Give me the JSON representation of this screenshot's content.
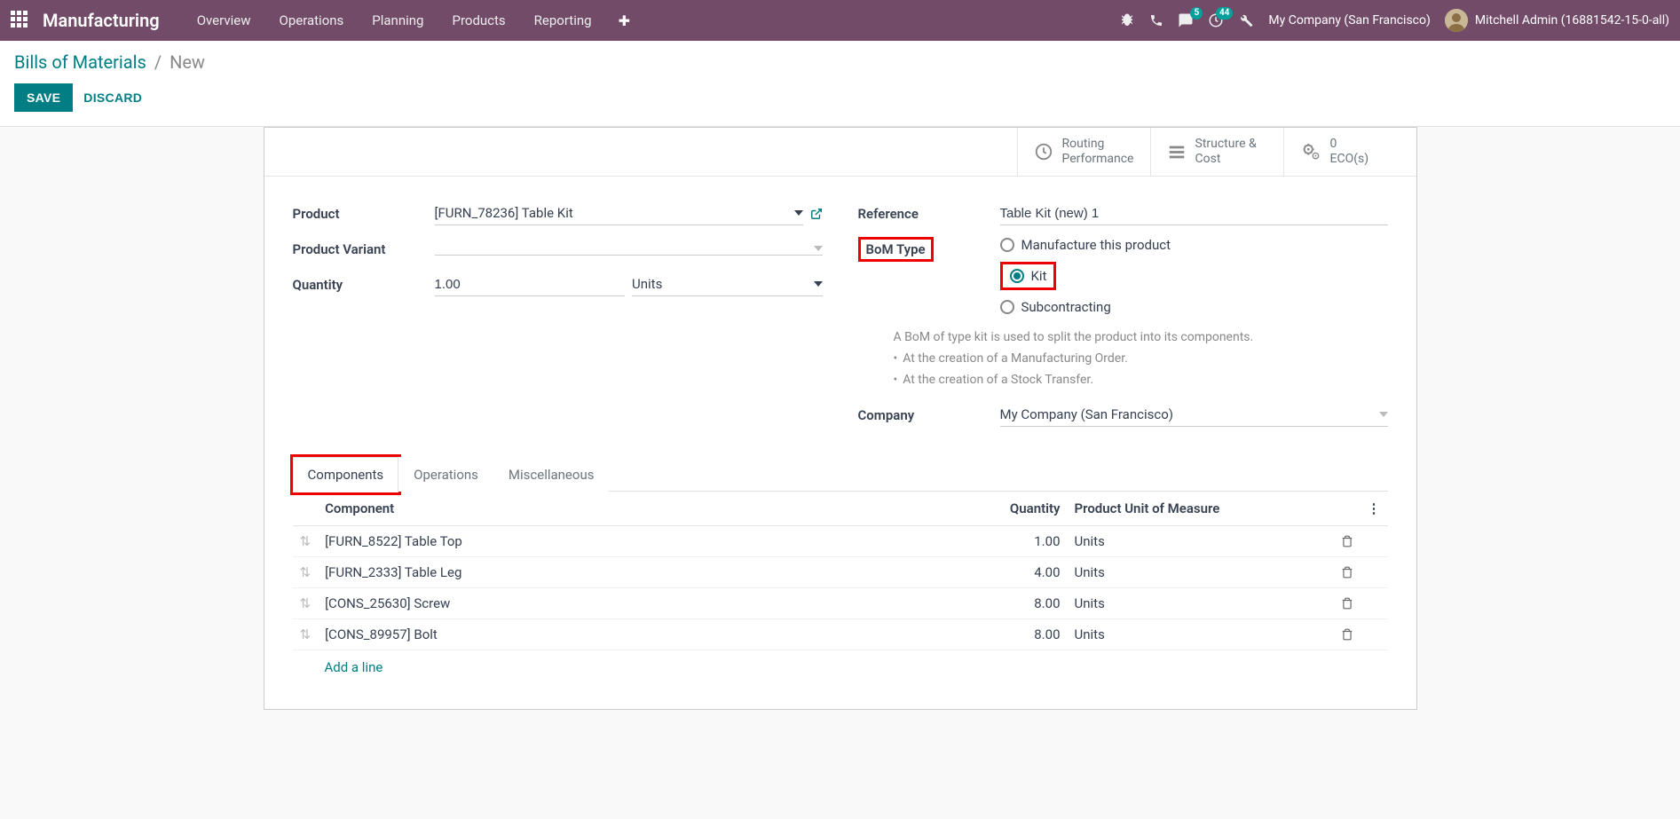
{
  "nav": {
    "brand": "Manufacturing",
    "menu": [
      "Overview",
      "Operations",
      "Planning",
      "Products",
      "Reporting"
    ],
    "badges": {
      "messages": "5",
      "activities": "44"
    },
    "company": "My Company (San Francisco)",
    "user": "Mitchell Admin (16881542-15-0-all)"
  },
  "breadcrumb": {
    "parent": "Bills of Materials",
    "current": "New"
  },
  "buttons": {
    "save": "SAVE",
    "discard": "DISCARD"
  },
  "stat_buttons": [
    {
      "line1": "Routing",
      "line2": "Performance"
    },
    {
      "line1": "Structure &",
      "line2": "Cost"
    },
    {
      "line1": "0",
      "line2": "ECO(s)"
    }
  ],
  "form": {
    "labels": {
      "product": "Product",
      "variant": "Product Variant",
      "quantity": "Quantity",
      "reference": "Reference",
      "bom_type": "BoM Type",
      "company": "Company"
    },
    "values": {
      "product": "[FURN_78236] Table Kit",
      "variant": "",
      "quantity": "1.00",
      "quantity_uom": "Units",
      "reference": "Table Kit (new) 1",
      "company": "My Company (San Francisco)"
    },
    "bom_type_options": [
      {
        "label": "Manufacture this product",
        "checked": false
      },
      {
        "label": "Kit",
        "checked": true
      },
      {
        "label": "Subcontracting",
        "checked": false
      }
    ],
    "help": {
      "intro": "A BoM of type kit is used to split the product into its components.",
      "b1": "At the creation of a Manufacturing Order.",
      "b2": "At the creation of a Stock Transfer."
    }
  },
  "tabs": [
    "Components",
    "Operations",
    "Miscellaneous"
  ],
  "table": {
    "headers": {
      "component": "Component",
      "quantity": "Quantity",
      "uom": "Product Unit of Measure"
    },
    "rows": [
      {
        "component": "[FURN_8522] Table Top",
        "qty": "1.00",
        "uom": "Units"
      },
      {
        "component": "[FURN_2333] Table Leg",
        "qty": "4.00",
        "uom": "Units"
      },
      {
        "component": "[CONS_25630] Screw",
        "qty": "8.00",
        "uom": "Units"
      },
      {
        "component": "[CONS_89957] Bolt",
        "qty": "8.00",
        "uom": "Units"
      }
    ],
    "add_line": "Add a line"
  }
}
